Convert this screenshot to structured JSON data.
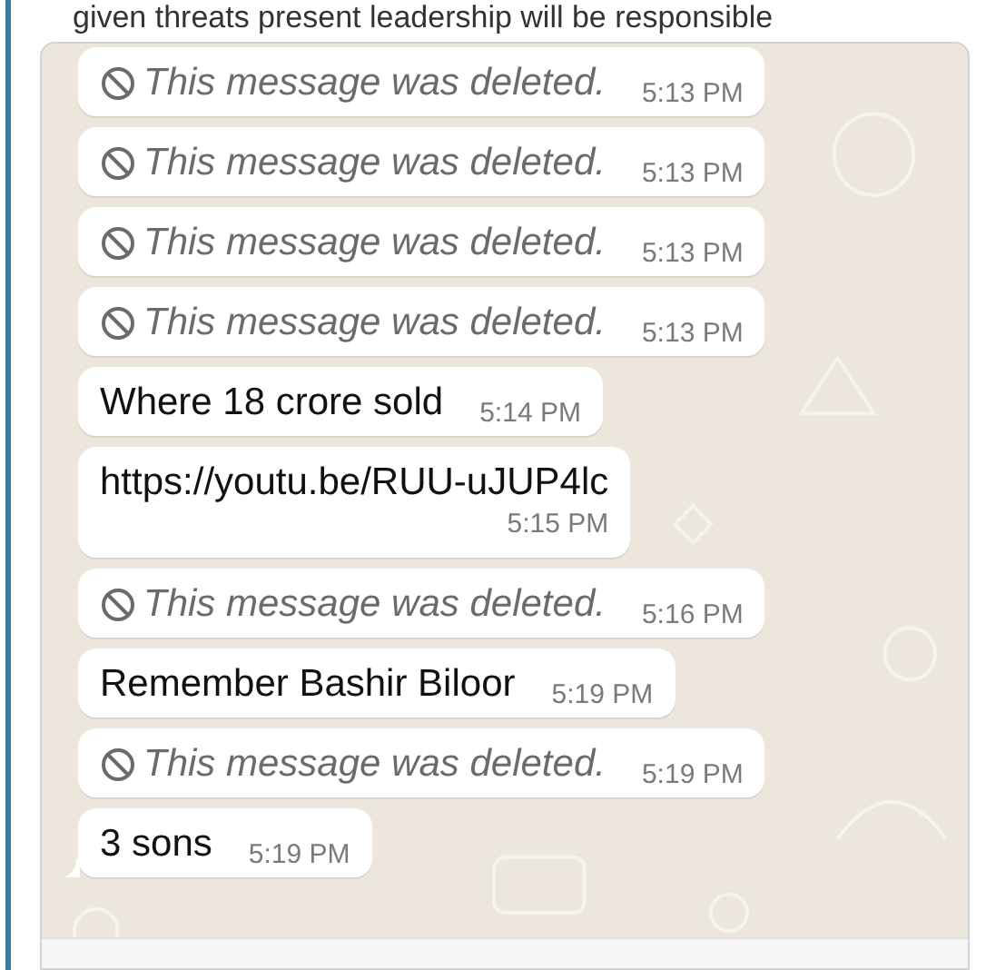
{
  "caption": "given threats present leadership will be responsible",
  "messages": [
    {
      "kind": "deleted",
      "text": "This message was deleted.",
      "time": "5:13 PM"
    },
    {
      "kind": "deleted",
      "text": "This message was deleted.",
      "time": "5:13 PM"
    },
    {
      "kind": "deleted",
      "text": "This message was deleted.",
      "time": "5:13 PM"
    },
    {
      "kind": "deleted",
      "text": "This message was deleted.",
      "time": "5:13 PM"
    },
    {
      "kind": "text",
      "text": "Where 18 crore sold",
      "time": "5:14 PM"
    },
    {
      "kind": "link",
      "text": "https://youtu.be/RUU-uJUP4lc",
      "time": "5:15 PM"
    },
    {
      "kind": "deleted",
      "text": "This message was deleted.",
      "time": "5:16 PM"
    },
    {
      "kind": "text",
      "text": "Remember  Bashir  Biloor",
      "time": "5:19 PM"
    },
    {
      "kind": "deleted",
      "text": "This message was deleted.",
      "time": "5:19 PM"
    },
    {
      "kind": "text",
      "text": "3 sons",
      "time": "5:19 PM",
      "tail": true
    }
  ]
}
